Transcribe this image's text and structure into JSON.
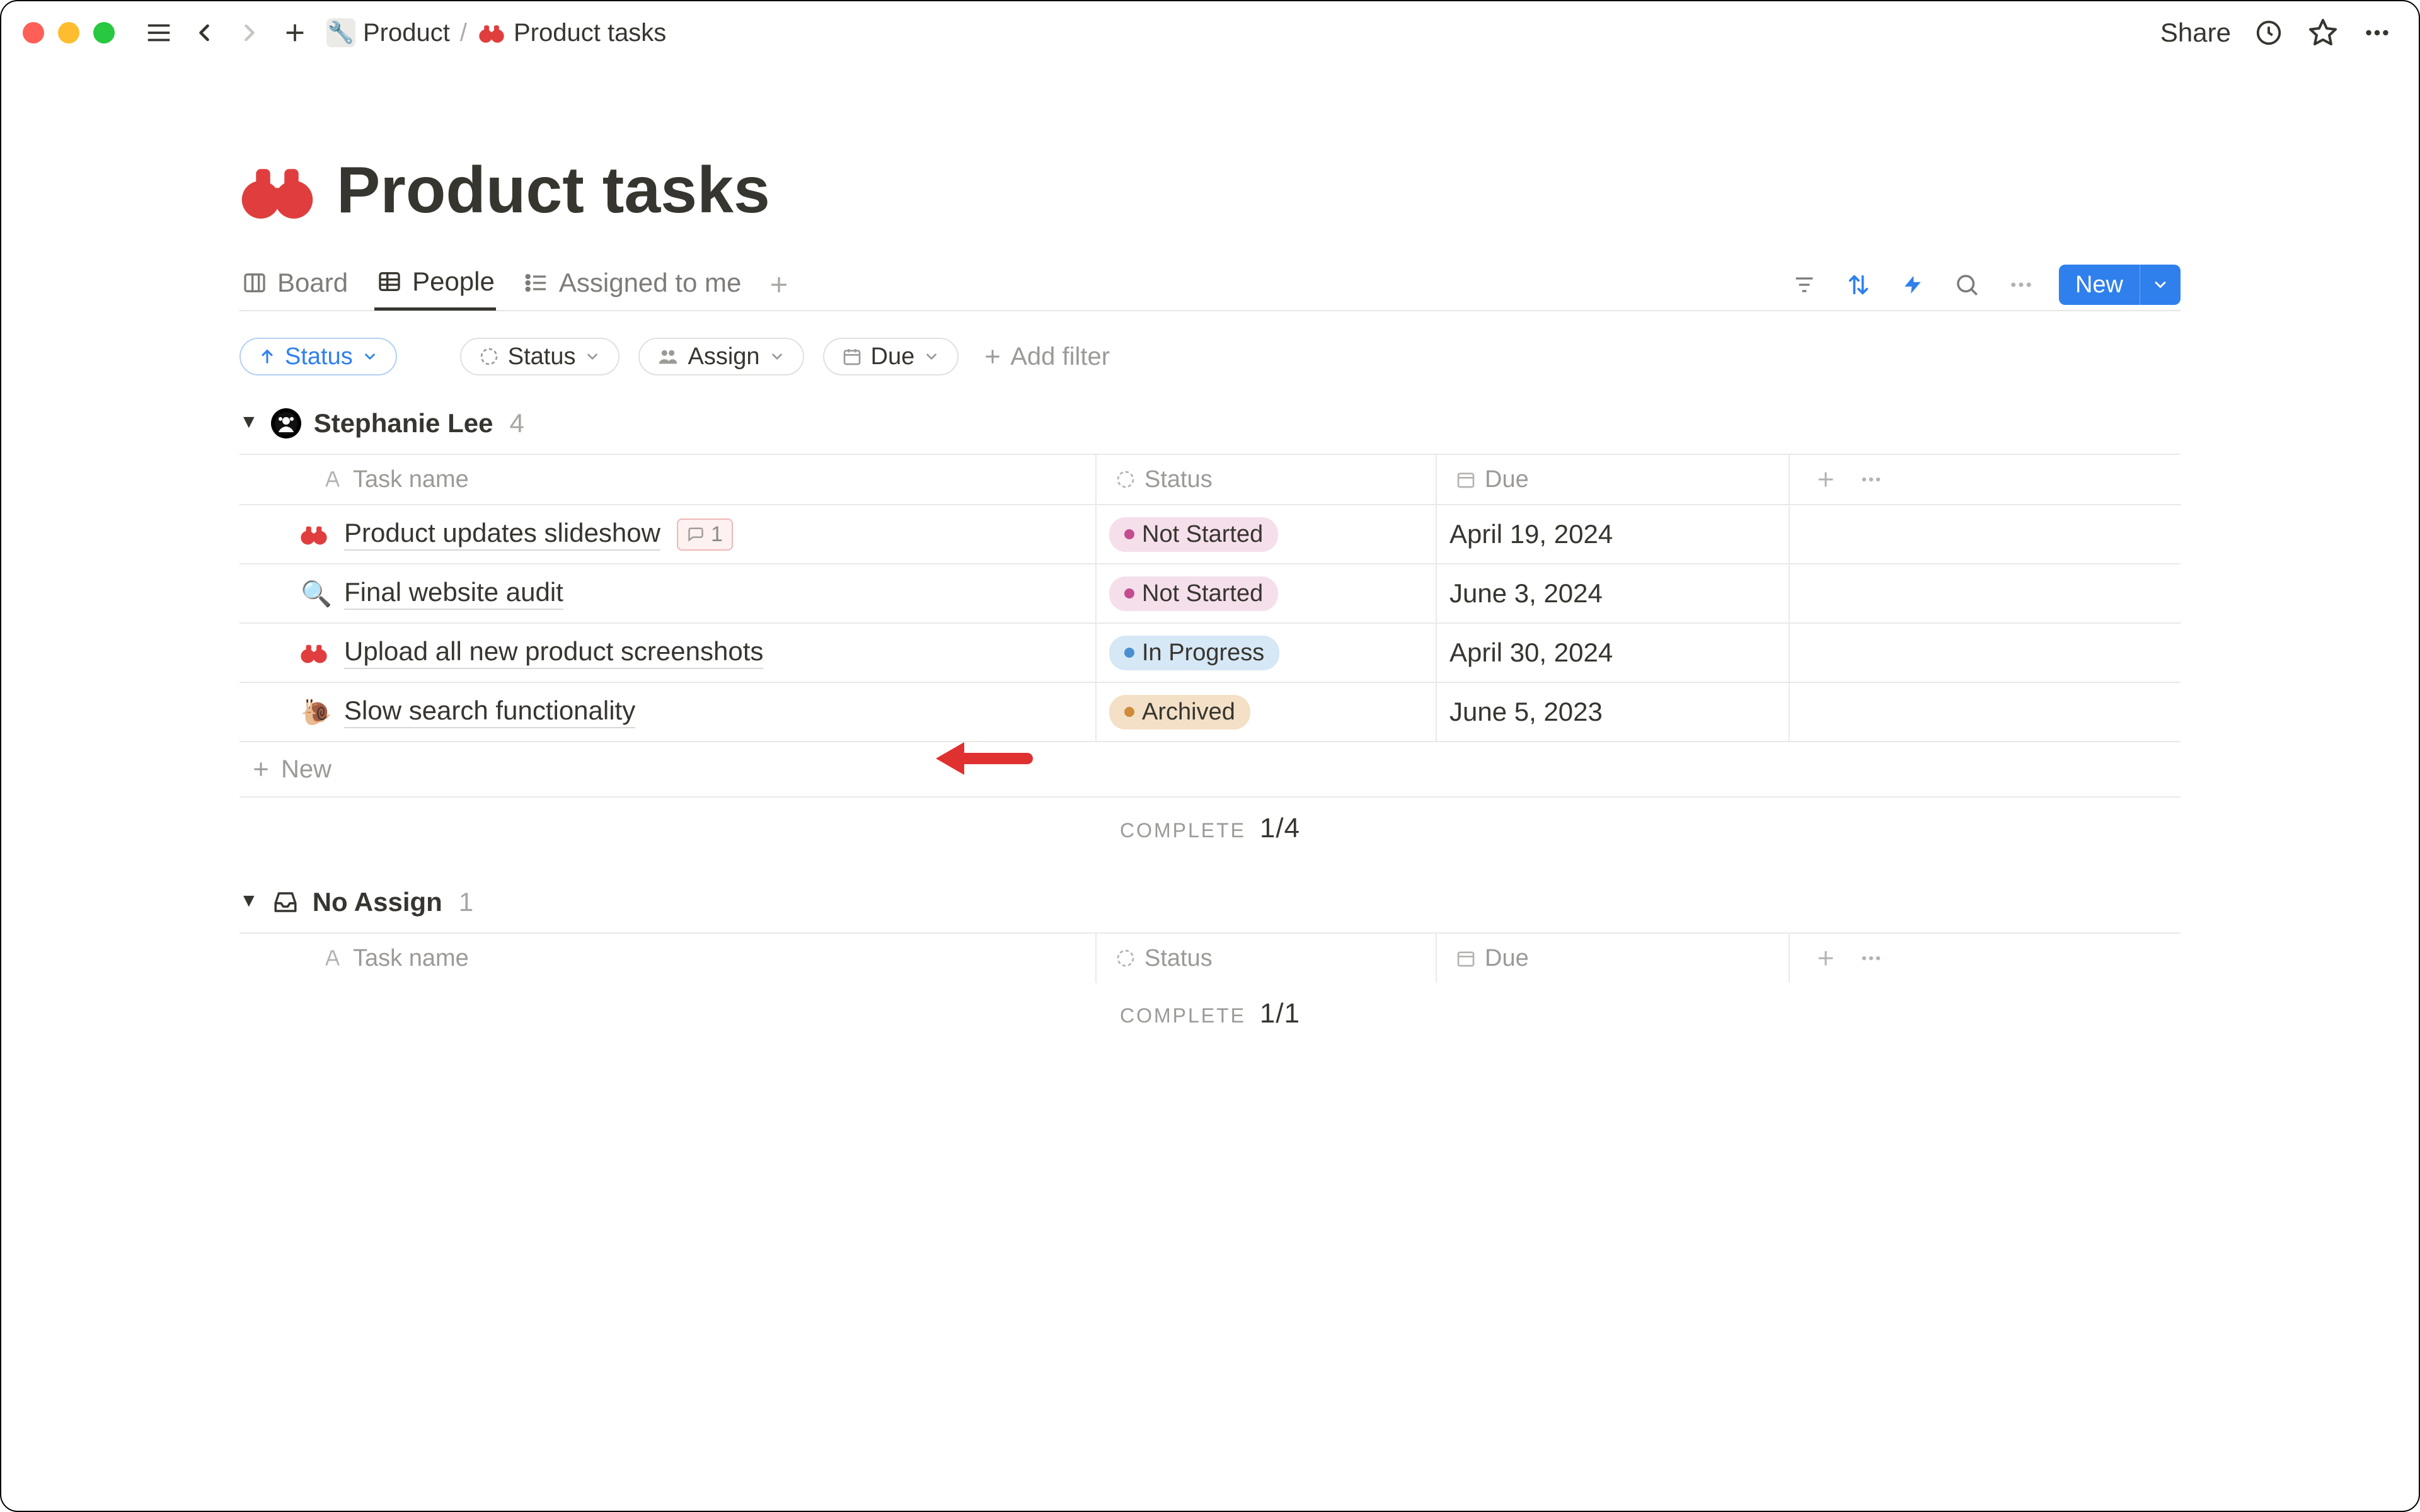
{
  "titlebar": {
    "breadcrumb": {
      "product": "Product",
      "page": "Product tasks"
    },
    "share": "Share"
  },
  "page": {
    "title": "Product tasks"
  },
  "tabs": {
    "board": "Board",
    "people": "People",
    "assigned": "Assigned to me",
    "new": "New"
  },
  "filters": {
    "sort": "Status",
    "status": "Status",
    "assign": "Assign",
    "due": "Due",
    "add": "Add filter"
  },
  "columns": {
    "task": "Task name",
    "status": "Status",
    "due": "Due"
  },
  "groups": [
    {
      "name": "Stephanie Lee",
      "count": "4",
      "type": "user",
      "rows": [
        {
          "emoji": "bino",
          "title": "Product updates slideshow",
          "comments": "1",
          "status": "Not Started",
          "statusClass": "status-notstarted",
          "due": "April 19, 2024"
        },
        {
          "emoji": "🔍",
          "title": "Final website audit",
          "status": "Not Started",
          "statusClass": "status-notstarted",
          "due": "June 3, 2024"
        },
        {
          "emoji": "bino",
          "title": "Upload all new product screenshots",
          "status": "In Progress",
          "statusClass": "status-inprogress",
          "due": "April 30, 2024"
        },
        {
          "emoji": "🐌",
          "title": "Slow search functionality",
          "status": "Archived",
          "statusClass": "status-archived",
          "due": "June 5, 2023"
        }
      ],
      "complete_label": "COMPLETE",
      "complete_value": "1/4",
      "new": "New"
    },
    {
      "name": "No Assign",
      "count": "1",
      "type": "none",
      "rows": [],
      "complete_label": "COMPLETE",
      "complete_value": "1/1"
    }
  ]
}
